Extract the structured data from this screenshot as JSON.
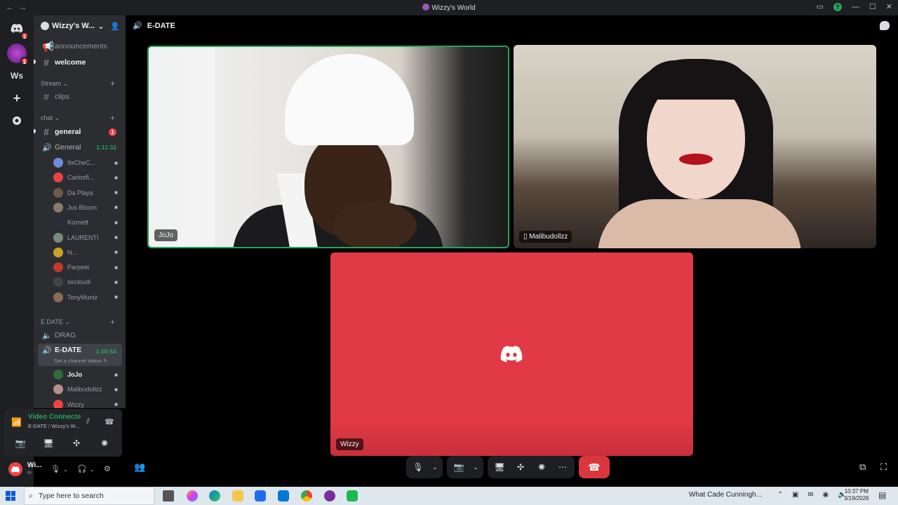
{
  "window": {
    "title": "Wizzy's World"
  },
  "servers": [
    {
      "name": "discord-home",
      "label": "",
      "badge": "1",
      "color": "#1e1f22"
    },
    {
      "name": "wizzys-world",
      "label": "",
      "badge": "1",
      "color": "#7b2ca0"
    },
    {
      "name": "ws",
      "label": "Ws",
      "badge": "",
      "color": "#1e1f22"
    },
    {
      "name": "add-server",
      "label": "+",
      "badge": "",
      "color": "#1e1f22"
    },
    {
      "name": "explore",
      "label": "",
      "badge": "",
      "color": "#1e1f22"
    }
  ],
  "guild": {
    "name": "Wizzy's W..."
  },
  "channels": {
    "announcements": "announcements",
    "welcome": "welcome",
    "cat_stream": "Stream",
    "clips": "clips",
    "cat_chat": "chat",
    "general": "general",
    "general_mentions": "1",
    "voice_general": "General",
    "voice_general_timer": "1:11:32",
    "cat_edate": "E DATE",
    "drag": "DRAG",
    "edate": "E-DATE",
    "edate_timer": "1:00:54",
    "edate_status": "Set a channel status"
  },
  "general_users": [
    {
      "name": "9xCheC...",
      "color": "#7289da"
    },
    {
      "name": "Carlosfl...",
      "color": "#ed4245"
    },
    {
      "name": "Da Playa",
      "color": "#6d5a4a"
    },
    {
      "name": "Jus Bloom",
      "color": "#8a7a6a"
    },
    {
      "name": "Kizmett",
      "color": "#2c2c3a"
    },
    {
      "name": "LAURENTI",
      "color": "#7a8a7a"
    },
    {
      "name": "N...",
      "color": "#c9a227"
    },
    {
      "name": "Paryeet",
      "color": "#c0392b"
    },
    {
      "name": "sircloudi",
      "color": "#444444"
    },
    {
      "name": "TonyMuniz",
      "color": "#8a6a5a"
    }
  ],
  "edate_users": [
    {
      "name": "JoJo",
      "color": "#2f6b3a"
    },
    {
      "name": "Malibudollzz",
      "color": "#b58f8a"
    },
    {
      "name": "Wizzy",
      "color": "#ed4245"
    }
  ],
  "voice_panel": {
    "status": "Video Connecte",
    "location": "E-DATE / Wizzy's W..."
  },
  "user": {
    "name": "Wi...",
    "status": "In"
  },
  "main": {
    "channel_title": "E-DATE",
    "tiles": [
      {
        "name": "JoJo"
      },
      {
        "name": "Malibudollzz"
      },
      {
        "name": "Wizzy"
      }
    ]
  },
  "taskbar": {
    "search_placeholder": "Type here to search",
    "news": "What Cade Cunningh...",
    "time": "10:37 PM",
    "date": "3/19/2026"
  }
}
